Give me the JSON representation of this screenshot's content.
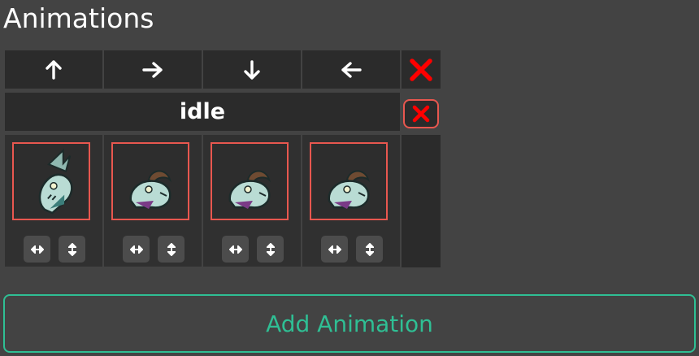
{
  "section_title": "Animations",
  "direction_headers": [
    {
      "symbol": "↑",
      "icon": "arrow-up-icon"
    },
    {
      "symbol": "→",
      "icon": "arrow-right-icon"
    },
    {
      "symbol": "↓",
      "icon": "arrow-down-icon"
    },
    {
      "symbol": "←",
      "icon": "arrow-left-icon"
    }
  ],
  "delete_icon": "close-icon",
  "animation": {
    "name": "idle",
    "frames": [
      {
        "sprite": "dragon-head-sprite",
        "facing": "up"
      },
      {
        "sprite": "dragon-head-sprite",
        "facing": "right"
      },
      {
        "sprite": "dragon-head-sprite",
        "facing": "down"
      },
      {
        "sprite": "dragon-head-sprite",
        "facing": "left"
      }
    ],
    "flip_icons": [
      "flip-horizontal-icon",
      "flip-vertical-icon"
    ]
  },
  "add_button_label": "Add Animation",
  "colors": {
    "background": "#434343",
    "cell": "#2b2b2b",
    "accent_red": "#e8574f",
    "delete_red": "#ff0000",
    "accent_green": "#2fbf94"
  }
}
